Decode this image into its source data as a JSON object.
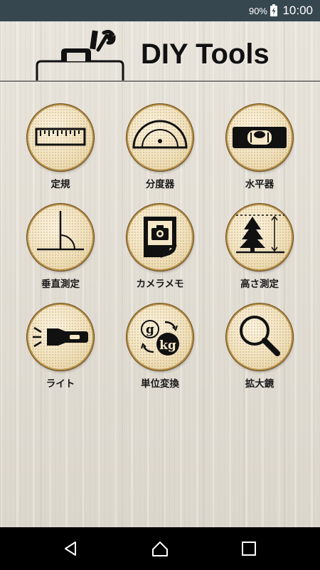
{
  "status_bar": {
    "battery": "90%",
    "time": "10:00"
  },
  "header": {
    "title": "DIY Tools"
  },
  "tools": [
    {
      "label": "定規",
      "icon": "ruler-icon"
    },
    {
      "label": "分度器",
      "icon": "protractor-icon"
    },
    {
      "label": "水平器",
      "icon": "spirit-level-icon"
    },
    {
      "label": "垂直測定",
      "icon": "vertical-angle-icon"
    },
    {
      "label": "カメラメモ",
      "icon": "camera-memo-icon"
    },
    {
      "label": "高さ測定",
      "icon": "tree-height-icon"
    },
    {
      "label": "ライト",
      "icon": "flashlight-icon"
    },
    {
      "label": "単位変換",
      "icon": "unit-conversion-icon"
    },
    {
      "label": "拡大鏡",
      "icon": "magnifier-icon"
    }
  ],
  "unit_icon_text": {
    "gram": "g",
    "kilogram": "kg"
  },
  "nav": {
    "icons": [
      "back-icon",
      "home-icon",
      "recents-icon"
    ]
  }
}
